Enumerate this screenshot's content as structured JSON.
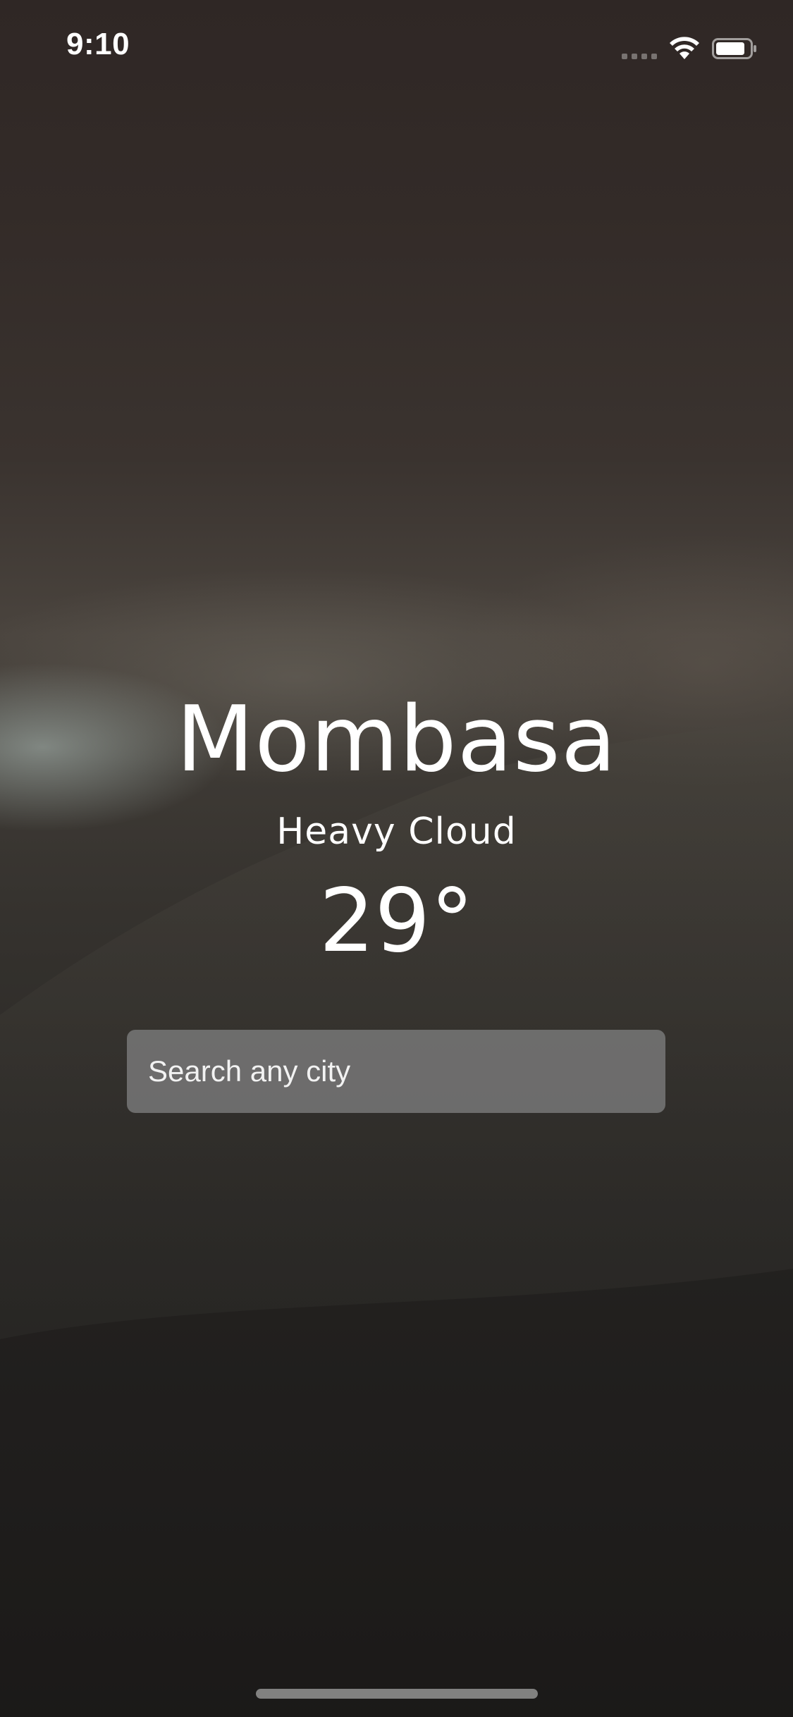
{
  "status_bar": {
    "time": "9:10",
    "signal_icon": "cellular-signal-icon",
    "wifi_icon": "wifi-icon",
    "battery_icon": "battery-icon"
  },
  "weather": {
    "city": "Mombasa",
    "condition": "Heavy Cloud",
    "temperature": "29°"
  },
  "search": {
    "placeholder": "Search any city",
    "value": ""
  },
  "colors": {
    "text": "#ffffff",
    "search_background": "#7a7a7a"
  }
}
